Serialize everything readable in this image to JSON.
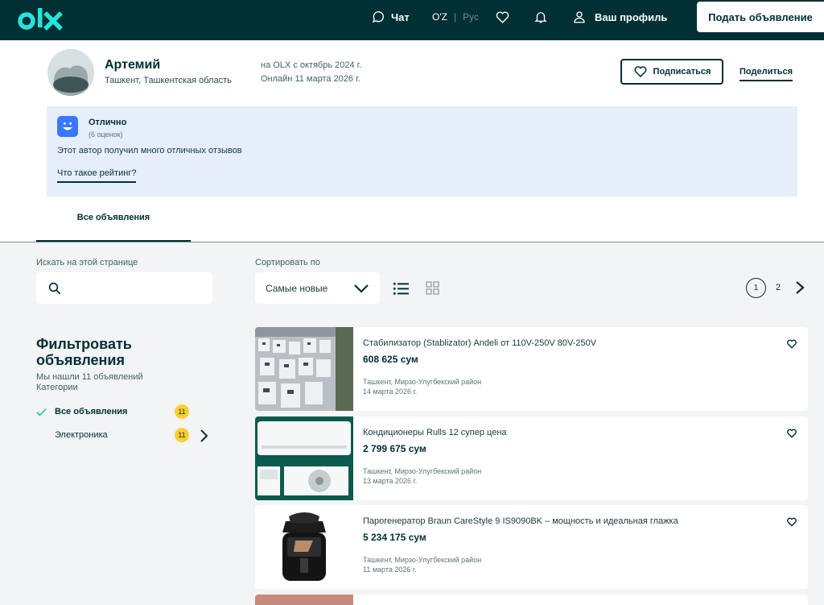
{
  "header": {
    "logo_text": "olx",
    "chat_label": "Чат",
    "lang_uz": "O'Z",
    "lang_sep": "|",
    "lang_ru": "Рус",
    "profile_label": "Ваш профиль",
    "post_button": "Подать объявление",
    "bg_color": "#002f34",
    "logo_color": "#23e5db"
  },
  "profile": {
    "name": "Артемий",
    "location": "Ташкент, Ташкентская область",
    "on_olx_since": "на OLX с октябрь 2024 г.",
    "online": "Онлайн 11 марта 2026 г.",
    "follow_button": "Подписаться",
    "share_link": "Поделиться"
  },
  "rating": {
    "title": "Отлично",
    "count": "(6 оценок)",
    "text": "Этот автор получил много отличных отзывов",
    "link": "Что такое рейтинг?"
  },
  "tabs": {
    "all": "Все объявления"
  },
  "search": {
    "label": "Искать на этой странице",
    "placeholder": ""
  },
  "sort": {
    "label": "Сортировать по",
    "selected": "Самые новые"
  },
  "pagination": {
    "current": "1",
    "next_page": "2"
  },
  "filters": {
    "title": "Фильтровать объявления",
    "found": "Мы нашли 11 объявлений",
    "categories_label": "Категории",
    "items": [
      {
        "label": "Все объявления",
        "count": "11"
      },
      {
        "label": "Электроника",
        "count": "11"
      }
    ]
  },
  "listings": [
    {
      "title": "Стабилизатор (Stablizator) Andeli от 110V-250V 80V-250V",
      "price": "608 625 сум",
      "location": "Ташкент, Мирзо-Улугбекский район",
      "date": "14 марта 2026 г."
    },
    {
      "title": "Кондиционеры Rulls 12 супер цена",
      "price": "2 799 675 сум",
      "location": "Ташкент, Мирзо-Улугбекский район",
      "date": "13 марта 2026 г."
    },
    {
      "title": "Парогенератор Braun CareStyle 9 IS9090BK – мощность и идеальная глажка",
      "price": "5 234 175 сум",
      "location": "Ташкент, Мирзо-Улугбекский район",
      "date": "11 марта 2026 г."
    }
  ]
}
